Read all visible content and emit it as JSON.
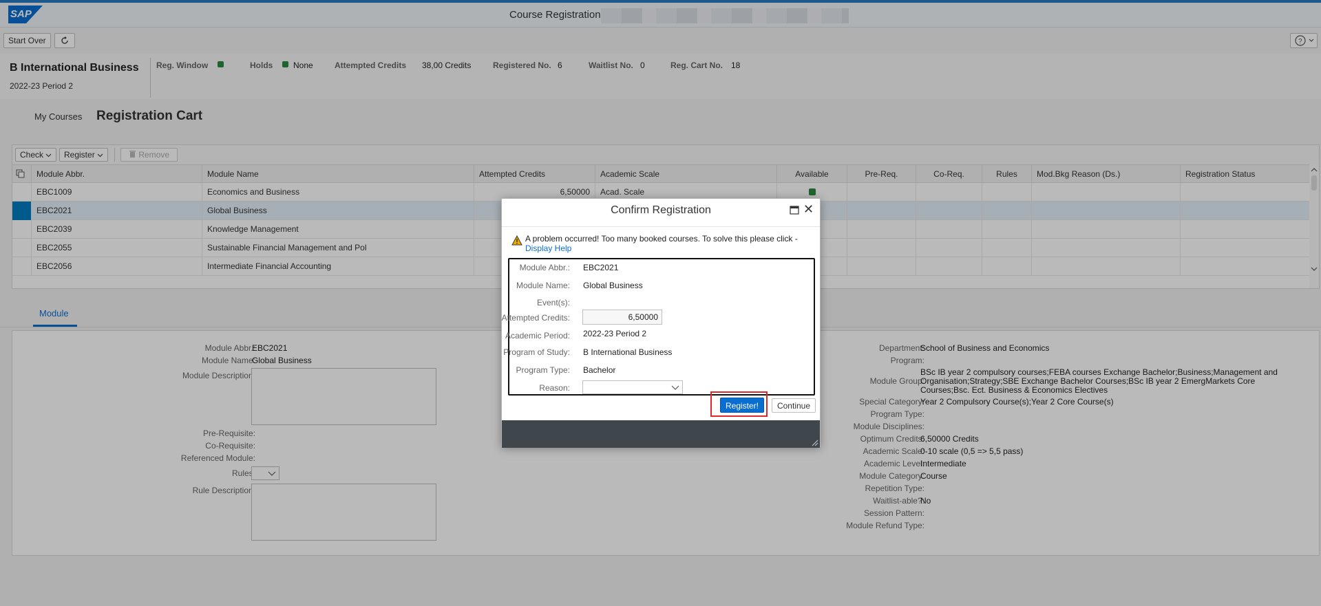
{
  "shell": {
    "logo_text": "SAP",
    "title": "Course Registration:"
  },
  "toolbar": {
    "start_over_label": "Start Over",
    "refresh_icon": "refresh-icon",
    "help_icon": "help-icon"
  },
  "header": {
    "program_title": "B International Business",
    "period": "2022-23 Period 2",
    "reg_window_label": "Reg. Window",
    "holds_label": "Holds",
    "holds_value": "None",
    "attempted_credits_label": "Attempted Credits",
    "attempted_credits_value": "38,00 Credits",
    "registered_no_label": "Registered No.",
    "registered_no_value": "6",
    "waitlist_no_label": "Waitlist No.",
    "waitlist_no_value": "0",
    "reg_cart_no_label": "Reg. Cart No.",
    "reg_cart_no_value": "18",
    "status_color": "#2b8a3e"
  },
  "subnav": {
    "my_courses": "My Courses",
    "page_title": "Registration Cart"
  },
  "table": {
    "toolbar": {
      "check_label": "Check",
      "register_label": "Register",
      "remove_label": "Remove"
    },
    "columns": [
      "Module Abbr.",
      "Module Name",
      "Attempted Credits",
      "Academic Scale",
      "Available",
      "Pre-Req.",
      "Co-Req.",
      "Rules",
      "Mod.Bkg Reason (Ds.)",
      "Registration Status"
    ],
    "rows": [
      {
        "abbr": "EBC1009",
        "name": "Economics and Business",
        "credits": "6,50000",
        "scale": "Acad. Scale",
        "available": true,
        "selected": false
      },
      {
        "abbr": "EBC2021",
        "name": "Global Business",
        "credits": "",
        "scale": "",
        "available": false,
        "selected": true
      },
      {
        "abbr": "EBC2039",
        "name": "Knowledge Management",
        "credits": "",
        "scale": "",
        "available": false,
        "selected": false
      },
      {
        "abbr": "EBC2055",
        "name": "Sustainable Financial Management and Pol",
        "credits": "",
        "scale": "",
        "available": false,
        "selected": false
      },
      {
        "abbr": "EBC2056",
        "name": "Intermediate Financial Accounting",
        "credits": "",
        "scale": "",
        "available": false,
        "selected": false
      }
    ]
  },
  "module_tab": {
    "label": "Module"
  },
  "module_detail": {
    "left": {
      "abbr_label": "Module Abbr.:",
      "abbr_value": "EBC2021",
      "name_label": "Module Name:",
      "name_value": "Global Business",
      "desc_label": "Module Description:",
      "prereq_label": "Pre-Requisite:",
      "coreq_label": "Co-Requisite:",
      "referenced_label": "Referenced Module:",
      "rules_label": "Rules:",
      "rule_desc_label": "Rule Description:"
    },
    "right": {
      "department_label": "Department:",
      "department_value": "School of Business and Economics",
      "program_label": "Program:",
      "module_group_label": "Module Group:",
      "module_group_value": "BSc IB year 2 compulsory courses;FEBA courses Exchange Bachelor;Business;Management and Organisation;Strategy;SBE Exchange Bachelor Courses;BSc IB year 2 EmergMarkets Core Courses;Bsc. Ect. Business & Economics Electives",
      "special_category_label": "Special Category:",
      "special_category_value": "Year 2 Compulsory Course(s);Year 2 Core Course(s)",
      "program_type_label": "Program Type:",
      "module_disciplines_label": "Module Disciplines:",
      "optimum_credits_label": "Optimum Credits:",
      "optimum_credits_value": "6,50000 Credits",
      "academic_scale_label": "Academic Scale:",
      "academic_scale_value": "0-10 scale (0,5 => 5,5 pass)",
      "academic_level_label": "Academic Level:",
      "academic_level_value": "Intermediate",
      "module_category_label": "Module Category:",
      "module_category_value": "Course",
      "repetition_type_label": "Repetition Type:",
      "waitlistable_label": "Waitlist-able?:",
      "waitlistable_value": "No",
      "session_pattern_label": "Session Pattern:",
      "refund_type_label": "Module Refund Type:"
    }
  },
  "dialog": {
    "title": "Confirm Registration",
    "warning_text": "A problem occurred! Too many booked courses. To solve this please click -",
    "help_link": "Display Help",
    "fields": {
      "abbr_label": "Module Abbr.:",
      "abbr_value": "EBC2021",
      "name_label": "Module Name:",
      "name_value": "Global Business",
      "events_label": "Event(s):",
      "credits_label": "Attempted Credits:",
      "credits_value": "6,50000",
      "period_label": "Academic Period:",
      "period_value": "2022-23 Period 2",
      "program_label": "Program of Study:",
      "program_value": "B International Business",
      "program_type_label": "Program Type:",
      "program_type_value": "Bachelor",
      "reason_label": "Reason:"
    },
    "register_label": "Register!",
    "continue_label": "Continue",
    "accent": "#0a6ed1",
    "highlight_color": "#e0252b"
  }
}
